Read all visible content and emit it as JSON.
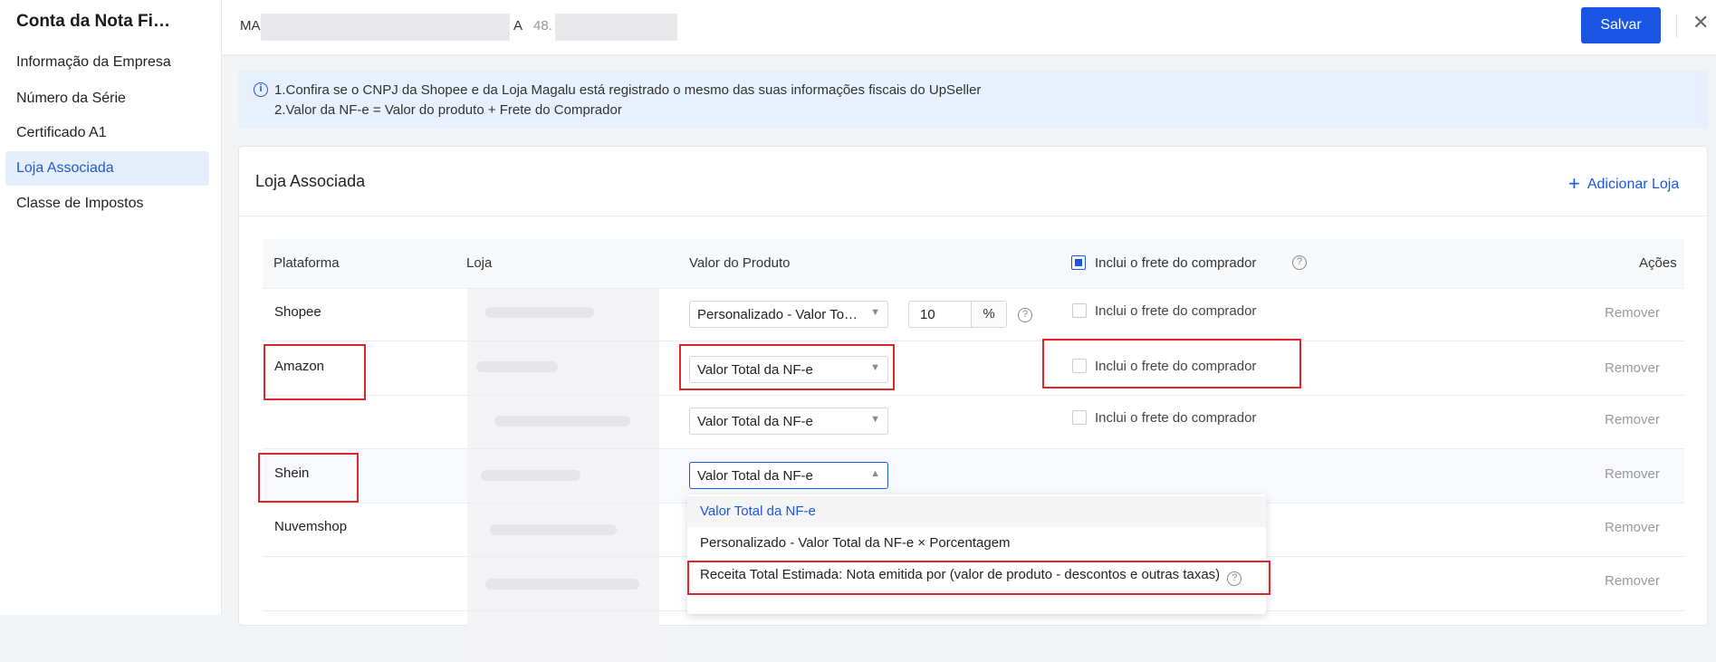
{
  "sidebar": {
    "title": "Conta da Nota Fi…",
    "items": [
      {
        "label": "Informação da Empresa"
      },
      {
        "label": "Número da Série"
      },
      {
        "label": "Certificado A1"
      },
      {
        "label": "Loja Associada"
      },
      {
        "label": "Classe de Impostos"
      }
    ]
  },
  "topbar": {
    "company_prefix": "MA",
    "company_suffix": "A",
    "cnpj_prefix": "48.",
    "save_label": "Salvar",
    "close_glyph": "✕"
  },
  "notice": {
    "line1": "1.Confira se o CNPJ da Shopee e da Loja Magalu está registrado o mesmo das suas informações fiscais do UpSeller",
    "line2": "2.Valor da NF-e = Valor do produto + Frete do Comprador"
  },
  "card": {
    "title": "Loja Associada",
    "add_label": "Adicionar Loja"
  },
  "table": {
    "headers": {
      "platform": "Plataforma",
      "store": "Loja",
      "product_value": "Valor do Produto",
      "freight": "Inclui o frete do comprador",
      "actions": "Ações"
    },
    "freight_header_checked": true,
    "rows": [
      {
        "platform": "Shopee",
        "value": "Personalizado - Valor To…",
        "percent": "10",
        "unit": "%",
        "freight": "Inclui o frete do comprador",
        "action": "Remover"
      },
      {
        "platform": "Amazon",
        "value": "Valor Total da NF-e",
        "freight": "Inclui o frete do comprador",
        "action": "Remover"
      },
      {
        "platform": "",
        "value": "Valor Total da NF-e",
        "freight": "Inclui o frete do comprador",
        "action": "Remover"
      },
      {
        "platform": "Shein",
        "value": "Valor Total da NF-e",
        "action": "Remover"
      },
      {
        "platform": "Nuvemshop",
        "action": "Remover"
      },
      {
        "platform": "",
        "action": "Remover"
      }
    ]
  },
  "dropdown": {
    "options": [
      {
        "label": "Valor Total da NF-e",
        "selected": true
      },
      {
        "label": "Personalizado - Valor Total da NF-e × Porcentagem",
        "selected": false
      },
      {
        "label": "Receita Total Estimada: Nota emitida por (valor de produto - descontos e outras taxas)",
        "selected": false
      }
    ]
  },
  "icons": {
    "info": "info-icon",
    "help": "help-circle-icon",
    "chevron": "chevron-down-icon",
    "plus": "plus-icon",
    "close": "close-icon"
  },
  "colors": {
    "accent": "#1a55e3",
    "highlight": "#e0262b",
    "notice_bg": "#e7f0fc"
  }
}
